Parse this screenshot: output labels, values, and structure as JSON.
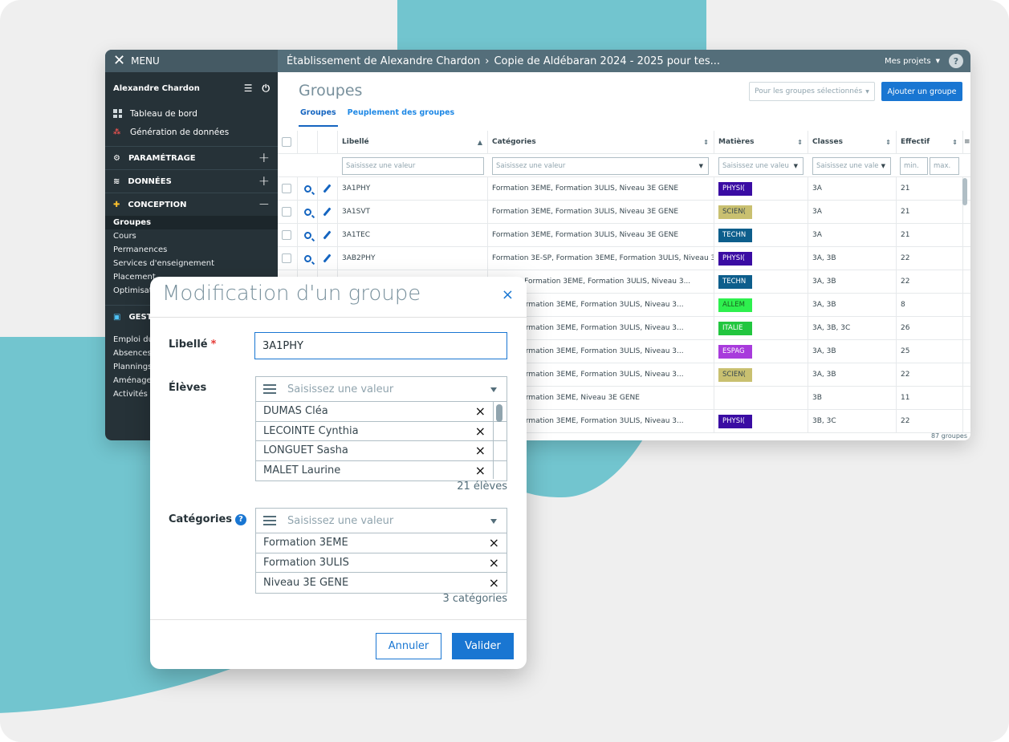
{
  "topbar": {
    "menu_label": "MENU",
    "breadcrumb": [
      "Établissement de Alexandre Chardon",
      "Copie de Aldébaran 2024 - 2025 pour tes..."
    ],
    "crumb_sep": "›",
    "projects_label": "Mes projets",
    "help": "?"
  },
  "sidebar": {
    "user": "Alexandre Chardon",
    "top_items": [
      "Tableau de bord",
      "Génération de données"
    ],
    "sections": [
      {
        "label": "PARAMÉTRAGE",
        "toggle": "+"
      },
      {
        "label": "DONNÉES",
        "toggle": "+"
      },
      {
        "label": "CONCEPTION",
        "toggle": "−"
      }
    ],
    "conception_items": [
      "Groupes",
      "Cours",
      "Permanences",
      "Services d'enseignement",
      "Placement",
      "Optimisat"
    ],
    "gest_label": "GEST",
    "gest_items": [
      "Emploi du",
      "Absences",
      "Plannings",
      "Aménager",
      "Activités é"
    ]
  },
  "main": {
    "title": "Groupes",
    "selected_btn": "Pour les groupes sélectionnés",
    "add_btn": "Ajouter un groupe",
    "tabs": [
      "Groupes",
      "Peuplement des groupes"
    ],
    "columns": [
      "Libellé",
      "Catégories",
      "Matières",
      "Classes",
      "Effectif"
    ],
    "filter_placeholder": "Saisissez une valeur",
    "filter_matieres": "Saisissez une valeu",
    "filter_classes": "Saisissez une vale",
    "filter_min": "min.",
    "filter_max": "max.",
    "rows": [
      {
        "libelle": "3A1PHY",
        "categories": "Formation 3EME, Formation 3ULIS, Niveau 3E GENE",
        "matiere": "PHYSI(",
        "color": "#3a0ca3",
        "classes": "3A",
        "effectif": "21"
      },
      {
        "libelle": "3A1SVT",
        "categories": "Formation 3EME, Formation 3ULIS, Niveau 3E GENE",
        "matiere": "SCIEN(",
        "color": "#c9c070",
        "classes": "3A",
        "effectif": "21"
      },
      {
        "libelle": "3A1TEC",
        "categories": "Formation 3EME, Formation 3ULIS, Niveau 3E GENE",
        "matiere": "TECHN",
        "color": "#0d5e8c",
        "classes": "3A",
        "effectif": "21"
      },
      {
        "libelle": "3AB2PHY",
        "categories": "Formation 3E-SP, Formation 3EME, Formation 3ULIS, Niveau 3...",
        "matiere": "PHYSI(",
        "color": "#3a0ca3",
        "classes": "3A, 3B",
        "effectif": "22"
      },
      {
        "libelle": "",
        "categories": "n 3E-SP, Formation 3EME, Formation 3ULIS, Niveau 3...",
        "matiere": "TECHN",
        "color": "#0d5e8c",
        "classes": "3A, 3B",
        "effectif": "22"
      },
      {
        "libelle": "",
        "categories": "3E-SP, Formation 3EME, Formation 3ULIS, Niveau 3...",
        "matiere": "ALLEM",
        "color": "#2ef04e",
        "classes": "3A, 3B",
        "effectif": "8"
      },
      {
        "libelle": "",
        "categories": "3E-SP, Formation 3EME, Formation 3ULIS, Niveau 3...",
        "matiere": "ITALIE",
        "color": "#22c63f",
        "classes": "3A, 3B, 3C",
        "effectif": "26"
      },
      {
        "libelle": "",
        "categories": "3E-SP, Formation 3EME, Formation 3ULIS, Niveau 3...",
        "matiere": "ESPAG",
        "color": "#a83bdc",
        "classes": "3A, 3B",
        "effectif": "25"
      },
      {
        "libelle": "",
        "categories": "3E-SP, Formation 3EME, Formation 3ULIS, Niveau 3...",
        "matiere": "SCIEN(",
        "color": "#c9c070",
        "classes": "3A, 3B",
        "effectif": "22"
      },
      {
        "libelle": "",
        "categories": "3E-SP, Formation 3EME, Niveau 3E GENE",
        "matiere": "",
        "color": "",
        "classes": "3B",
        "effectif": "11"
      },
      {
        "libelle": "",
        "categories": "3E-SP, Formation 3EME, Formation 3ULIS, Niveau 3...",
        "matiere": "PHYSI(",
        "color": "#3a0ca3",
        "classes": "3B, 3C",
        "effectif": "22"
      }
    ],
    "total": "87 groupes"
  },
  "modal": {
    "title": "Modification d'un groupe",
    "close": "×",
    "libelle_label": "Libellé",
    "required": "*",
    "libelle_value": "3A1PHY",
    "eleves_label": "Élèves",
    "select_placeholder": "Saisissez une valeur",
    "eleves": [
      "DUMAS Cléa",
      "LECOINTE Cynthia",
      "LONGUET Sasha",
      "MALET Laurine"
    ],
    "eleves_count": "21 élèves",
    "categories_label": "Catégories",
    "categories": [
      "Formation 3EME",
      "Formation 3ULIS",
      "Niveau 3E GENE"
    ],
    "categories_count": "3 catégories",
    "remove": "×",
    "cancel": "Annuler",
    "ok": "Valider"
  }
}
